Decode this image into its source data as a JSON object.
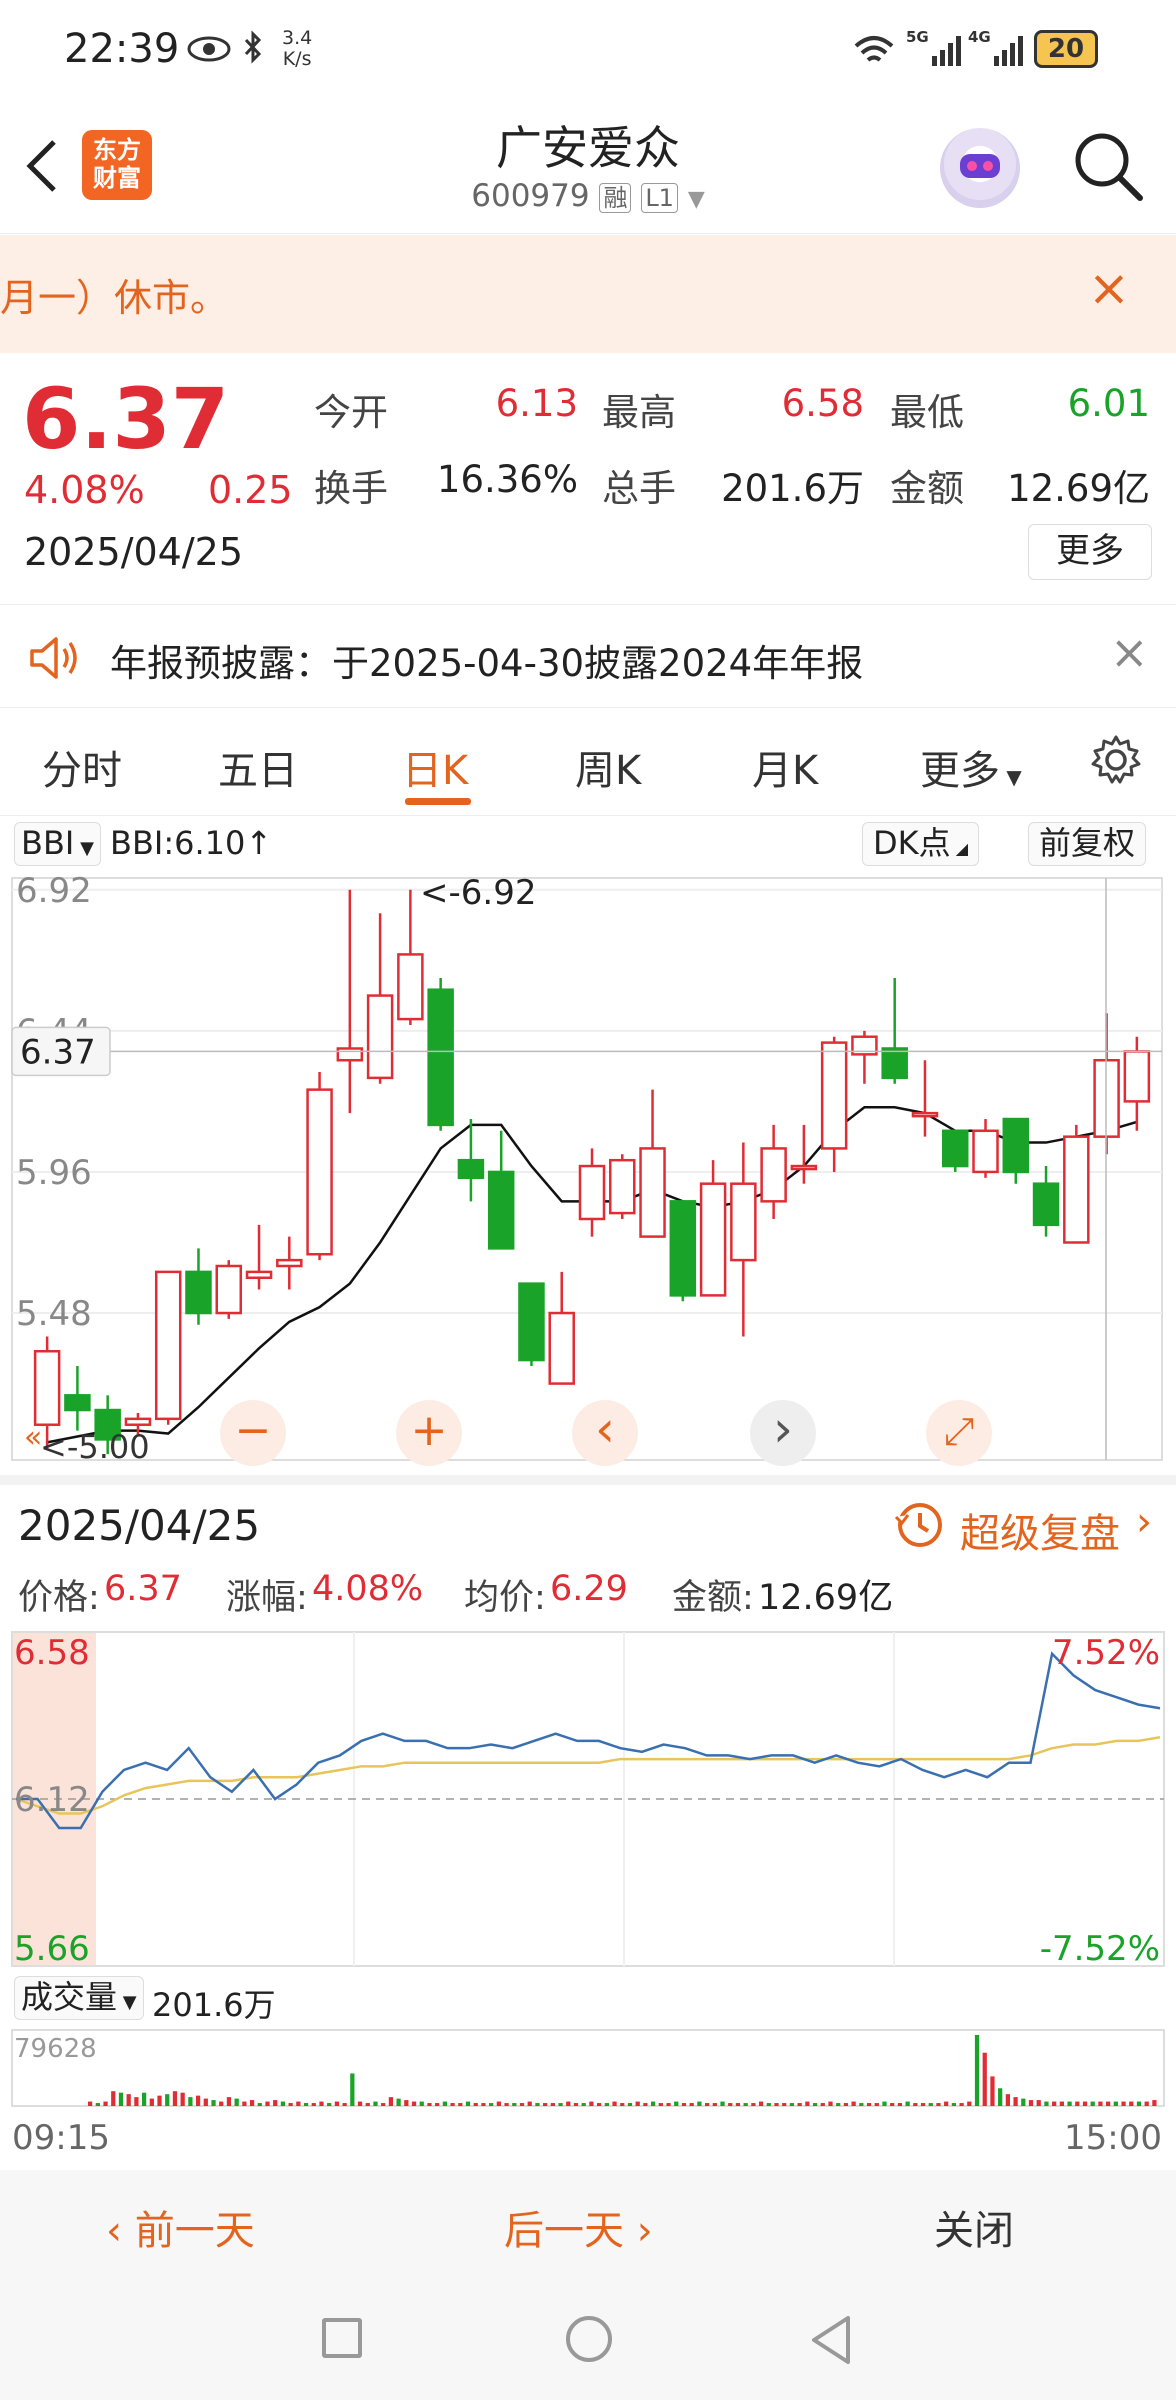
{
  "status_bar": {
    "time": "22:39",
    "speed": "3.4\nK/s",
    "network": "5G 4G",
    "battery": "20"
  },
  "header": {
    "logo": "东方\n财富",
    "stock_name": "广安爱众",
    "stock_code": "600979",
    "tag_margin": "融",
    "tag_level": "L1"
  },
  "notice": {
    "text": "月一）休市。"
  },
  "quote": {
    "price": "6.37",
    "change_pct": "4.08%",
    "change": "0.25",
    "date": "2025/04/25",
    "open_label": "今开",
    "open": "6.13",
    "high_label": "最高",
    "high": "6.58",
    "low_label": "最低",
    "low": "6.01",
    "turnover_label": "换手",
    "turnover": "16.36%",
    "volume_label": "总手",
    "volume": "201.6万",
    "amount_label": "金额",
    "amount": "12.69亿",
    "more": "更多"
  },
  "announcement": {
    "text": "年报预披露：于2025-04-30披露2024年年报"
  },
  "tabs": [
    "分时",
    "五日",
    "日K",
    "周K",
    "月K",
    "更多"
  ],
  "active_tab": "日K",
  "kline_toolbar": {
    "indicator": "BBI",
    "indicator_value": "BBI:6.10↑",
    "dk": "DK点",
    "adjust": "前复权"
  },
  "chart_data": [
    {
      "type": "candlestick",
      "y_ticks": [
        "6.92",
        "6.44",
        "5.96",
        "5.48"
      ],
      "ylim": [
        5.0,
        6.92
      ],
      "current_price_label": "6.37",
      "max_label": "<-6.92",
      "min_label": "<-5.00",
      "candles": [
        {
          "o": 5.1,
          "c": 5.35,
          "h": 5.4,
          "l": 5.02
        },
        {
          "o": 5.2,
          "c": 5.15,
          "h": 5.3,
          "l": 5.08
        },
        {
          "o": 5.15,
          "c": 5.05,
          "h": 5.2,
          "l": 5.0
        },
        {
          "o": 5.1,
          "c": 5.12,
          "h": 5.14,
          "l": 5.06
        },
        {
          "o": 5.12,
          "c": 5.62,
          "h": 5.62,
          "l": 5.1
        },
        {
          "o": 5.62,
          "c": 5.48,
          "h": 5.7,
          "l": 5.44
        },
        {
          "o": 5.48,
          "c": 5.64,
          "h": 5.66,
          "l": 5.46
        },
        {
          "o": 5.6,
          "c": 5.62,
          "h": 5.78,
          "l": 5.56
        },
        {
          "o": 5.64,
          "c": 5.66,
          "h": 5.74,
          "l": 5.56
        },
        {
          "o": 5.68,
          "c": 6.24,
          "h": 6.3,
          "l": 5.66
        },
        {
          "o": 6.34,
          "c": 6.38,
          "h": 6.92,
          "l": 6.16
        },
        {
          "o": 6.28,
          "c": 6.56,
          "h": 6.84,
          "l": 6.26
        },
        {
          "o": 6.48,
          "c": 6.7,
          "h": 6.92,
          "l": 6.46
        },
        {
          "o": 6.58,
          "c": 6.12,
          "h": 6.62,
          "l": 6.1
        },
        {
          "o": 6.0,
          "c": 5.94,
          "h": 6.14,
          "l": 5.86
        },
        {
          "o": 5.96,
          "c": 5.7,
          "h": 6.1,
          "l": 5.7
        },
        {
          "o": 5.58,
          "c": 5.32,
          "h": 5.58,
          "l": 5.3
        },
        {
          "o": 5.24,
          "c": 5.48,
          "h": 5.62,
          "l": 5.24
        },
        {
          "o": 5.8,
          "c": 5.98,
          "h": 6.04,
          "l": 5.74
        },
        {
          "o": 5.82,
          "c": 6.0,
          "h": 6.02,
          "l": 5.8
        },
        {
          "o": 5.74,
          "c": 6.04,
          "h": 6.24,
          "l": 5.74
        },
        {
          "o": 5.86,
          "c": 5.54,
          "h": 5.86,
          "l": 5.52
        },
        {
          "o": 5.54,
          "c": 5.92,
          "h": 6.0,
          "l": 5.54
        },
        {
          "o": 5.66,
          "c": 5.92,
          "h": 6.06,
          "l": 5.4
        },
        {
          "o": 5.86,
          "c": 6.04,
          "h": 6.12,
          "l": 5.8
        },
        {
          "o": 5.98,
          "c": 5.98,
          "h": 6.12,
          "l": 5.92
        },
        {
          "o": 6.04,
          "c": 6.4,
          "h": 6.42,
          "l": 5.96
        },
        {
          "o": 6.36,
          "c": 6.42,
          "h": 6.44,
          "l": 6.26
        },
        {
          "o": 6.38,
          "c": 6.28,
          "h": 6.62,
          "l": 6.26
        },
        {
          "o": 6.16,
          "c": 6.16,
          "h": 6.34,
          "l": 6.08
        },
        {
          "o": 6.1,
          "c": 5.98,
          "h": 6.1,
          "l": 5.96
        },
        {
          "o": 5.96,
          "c": 6.1,
          "h": 6.14,
          "l": 5.94
        },
        {
          "o": 6.14,
          "c": 5.96,
          "h": 6.14,
          "l": 5.92
        },
        {
          "o": 5.92,
          "c": 5.78,
          "h": 5.98,
          "l": 5.74
        },
        {
          "o": 5.72,
          "c": 6.08,
          "h": 6.12,
          "l": 5.72
        },
        {
          "o": 6.08,
          "c": 6.34,
          "h": 6.5,
          "l": 6.02
        },
        {
          "o": 6.2,
          "c": 6.37,
          "h": 6.42,
          "l": 6.1
        }
      ],
      "bbi": [
        5.04,
        5.06,
        5.08,
        5.08,
        5.07,
        5.16,
        5.26,
        5.36,
        5.45,
        5.5,
        5.58,
        5.72,
        5.88,
        6.04,
        6.12,
        6.12,
        5.98,
        5.86,
        5.86,
        5.86,
        5.9,
        5.86,
        5.84,
        5.86,
        5.9,
        5.98,
        6.1,
        6.18,
        6.18,
        6.16,
        6.1,
        6.1,
        6.06,
        6.06,
        6.08,
        6.1,
        6.13
      ]
    },
    {
      "type": "line",
      "title": "2025/04/25",
      "ylim": [
        5.66,
        6.58
      ],
      "y_labels": {
        "top": "6.58",
        "mid": "6.12",
        "bottom": "5.66",
        "top_pct": "7.52%",
        "bottom_pct": "-7.52%"
      },
      "x_labels": [
        "09:15",
        "15:00"
      ],
      "price": [
        6.12,
        6.12,
        6.04,
        6.04,
        6.14,
        6.2,
        6.22,
        6.2,
        6.26,
        6.18,
        6.14,
        6.2,
        6.12,
        6.16,
        6.22,
        6.24,
        6.28,
        6.3,
        6.28,
        6.28,
        6.26,
        6.26,
        6.27,
        6.26,
        6.28,
        6.3,
        6.28,
        6.28,
        6.26,
        6.25,
        6.27,
        6.26,
        6.24,
        6.24,
        6.23,
        6.24,
        6.24,
        6.22,
        6.24,
        6.22,
        6.21,
        6.23,
        6.2,
        6.18,
        6.2,
        6.18,
        6.22,
        6.22,
        6.52,
        6.46,
        6.42,
        6.4,
        6.38,
        6.37
      ],
      "avg": [
        6.12,
        6.1,
        6.08,
        6.08,
        6.1,
        6.13,
        6.15,
        6.16,
        6.17,
        6.17,
        6.17,
        6.18,
        6.18,
        6.18,
        6.19,
        6.2,
        6.21,
        6.21,
        6.22,
        6.22,
        6.22,
        6.22,
        6.22,
        6.22,
        6.22,
        6.22,
        6.22,
        6.22,
        6.23,
        6.23,
        6.23,
        6.23,
        6.23,
        6.23,
        6.23,
        6.23,
        6.23,
        6.23,
        6.23,
        6.23,
        6.23,
        6.23,
        6.23,
        6.23,
        6.23,
        6.23,
        6.23,
        6.24,
        6.26,
        6.27,
        6.27,
        6.28,
        6.28,
        6.29
      ]
    }
  ],
  "buttons": {
    "zoom_out": "−",
    "zoom_in": "+",
    "prev": "‹",
    "next": "›",
    "fullscreen": "⤢"
  },
  "detail": {
    "date": "2025/04/25",
    "replay": "超级复盘",
    "price_label": "价格:",
    "price": "6.37",
    "pct_label": "涨幅:",
    "pct": "4.08%",
    "avg_label": "均价:",
    "avg": "6.29",
    "amount_label": "金额:",
    "amount": "12.69亿",
    "volume_label": "成交量",
    "volume_total": "201.6万",
    "volume_max": "79628",
    "volume_bars": [
      3,
      2,
      3,
      10,
      9,
      8,
      6,
      9,
      5,
      7,
      8,
      10,
      9,
      6,
      7,
      5,
      4,
      3,
      6,
      5,
      3,
      4,
      2,
      3,
      4,
      3,
      2,
      3,
      2,
      2,
      3,
      2,
      3,
      2,
      22,
      3,
      2,
      3,
      2,
      6,
      5,
      4,
      3,
      3,
      2,
      2,
      3,
      2,
      2,
      3,
      2,
      2,
      2,
      3,
      2,
      2,
      2,
      3,
      2,
      2,
      2,
      2,
      3,
      2,
      2,
      3,
      2,
      2,
      3,
      2,
      2,
      3,
      2,
      3,
      2,
      2,
      3,
      2,
      2,
      3,
      2,
      2,
      3,
      2,
      2,
      2,
      2,
      3,
      2,
      2,
      2,
      2,
      2,
      3,
      2,
      2,
      3,
      2,
      2,
      3,
      2,
      2,
      2,
      3,
      2,
      2,
      3,
      2,
      2,
      2,
      2,
      3,
      2,
      2,
      3,
      48,
      36,
      20,
      12,
      8,
      6,
      5,
      4,
      4,
      3,
      3,
      3,
      3,
      3,
      3,
      3,
      3,
      3,
      3,
      3,
      3,
      3,
      3,
      4
    ]
  },
  "footer": {
    "prev": "前一天",
    "next": "后一天",
    "close": "关闭"
  },
  "colors": {
    "red": "#e02d35",
    "green": "#1aa329",
    "orange": "#e3641e",
    "blue": "#3a6fb0",
    "yellow": "#e8c55a"
  }
}
